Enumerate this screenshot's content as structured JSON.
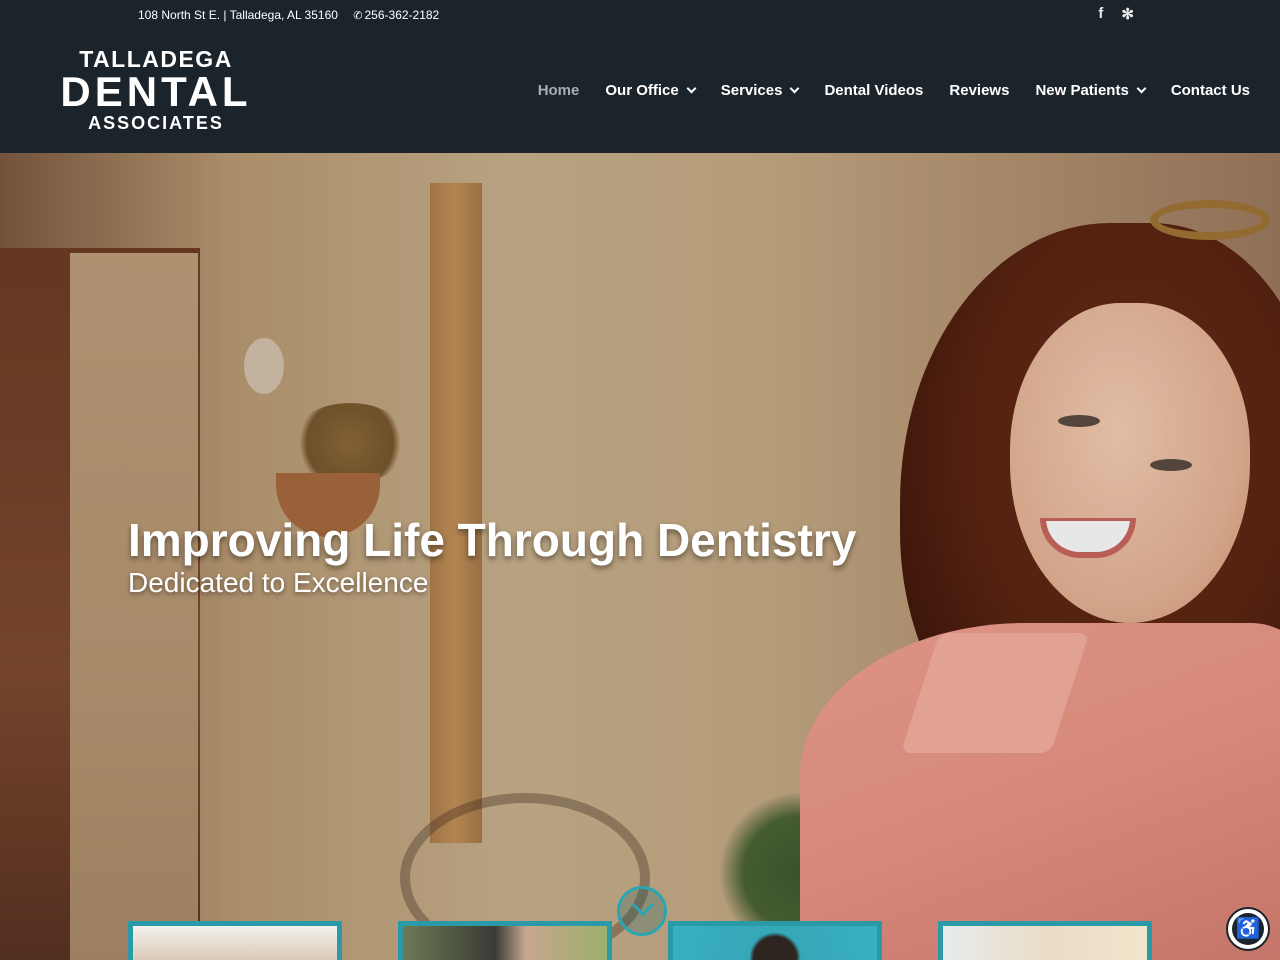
{
  "topbar": {
    "address": "108 North St E. | Talladega, AL 35160",
    "phone_icon": "phone-icon",
    "phone": "256-362-2182",
    "social": [
      {
        "name": "facebook-icon",
        "glyph": "f"
      },
      {
        "name": "yelp-icon",
        "glyph": "✻"
      }
    ]
  },
  "logo": {
    "line1": "TALLADEGA",
    "line2": "DENTAL",
    "line3": "ASSOCIATES"
  },
  "nav": {
    "items": [
      {
        "label": "Home",
        "active": true,
        "dropdown": false
      },
      {
        "label": "Our Office",
        "active": false,
        "dropdown": true
      },
      {
        "label": "Services",
        "active": false,
        "dropdown": true
      },
      {
        "label": "Dental Videos",
        "active": false,
        "dropdown": false
      },
      {
        "label": "Reviews",
        "active": false,
        "dropdown": false
      },
      {
        "label": "New Patients",
        "active": false,
        "dropdown": true
      },
      {
        "label": "Contact Us",
        "active": false,
        "dropdown": false
      }
    ]
  },
  "hero": {
    "headline": "Improving Life Through Dentistry",
    "subline": "Dedicated to Excellence",
    "scroll_icon": "chevron-down-icon"
  },
  "cards": [
    {
      "name": "feature-card-1"
    },
    {
      "name": "feature-card-2"
    },
    {
      "name": "feature-card-3"
    },
    {
      "name": "feature-card-4"
    }
  ],
  "colors": {
    "header_bg": "#1c242b",
    "accent": "#2a9aa8",
    "nav_active": "#a9adb1"
  },
  "accessibility_icon": "accessibility-icon"
}
